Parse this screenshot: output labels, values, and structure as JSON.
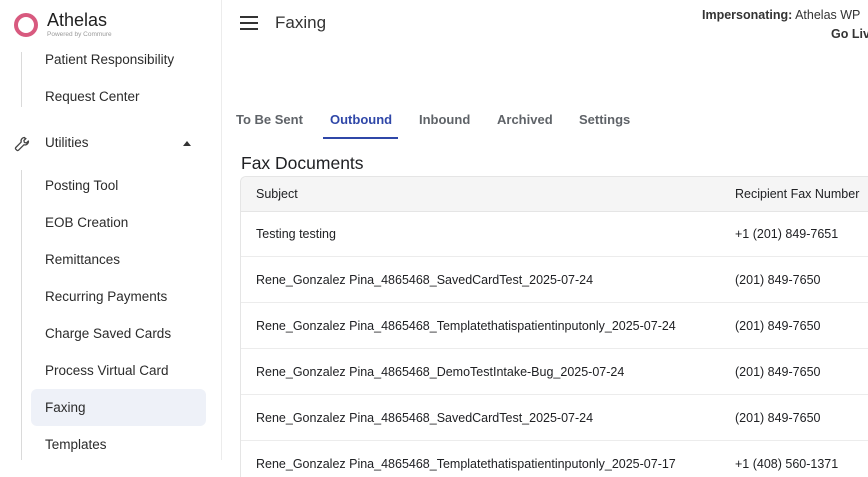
{
  "brand": {
    "name": "Athelas",
    "sub": "Powered by Commure"
  },
  "sidebar": {
    "partial_item": "Patient Responsibility",
    "request_center": "Request Center",
    "utilities": "Utilities",
    "items": [
      {
        "label": "Posting Tool"
      },
      {
        "label": "EOB Creation"
      },
      {
        "label": "Remittances"
      },
      {
        "label": "Recurring Payments"
      },
      {
        "label": "Charge Saved Cards"
      },
      {
        "label": "Process Virtual Card"
      },
      {
        "label": "Faxing"
      },
      {
        "label": "Templates"
      }
    ],
    "active": "Faxing"
  },
  "header": {
    "title": "Faxing",
    "impersonating_label": "Impersonating:",
    "impersonating_value": "Athelas WP",
    "go_live": "Go Liv"
  },
  "tabs": [
    {
      "label": "To Be Sent"
    },
    {
      "label": "Outbound"
    },
    {
      "label": "Inbound"
    },
    {
      "label": "Archived"
    },
    {
      "label": "Settings"
    }
  ],
  "active_tab": "Outbound",
  "section_title": "Fax Documents",
  "table": {
    "columns": [
      "Subject",
      "Recipient Fax Number"
    ],
    "rows": [
      {
        "subject": "Testing testing",
        "fax": "+1 (201) 849-7651"
      },
      {
        "subject": "Rene_Gonzalez Pina_4865468_SavedCardTest_2025-07-24",
        "fax": "(201) 849-7650"
      },
      {
        "subject": "Rene_Gonzalez Pina_4865468_Templatethatispatientinputonly_2025-07-24",
        "fax": "(201) 849-7650"
      },
      {
        "subject": "Rene_Gonzalez Pina_4865468_DemoTestIntake-Bug_2025-07-24",
        "fax": "(201) 849-7650"
      },
      {
        "subject": "Rene_Gonzalez Pina_4865468_SavedCardTest_2025-07-24",
        "fax": "(201) 849-7650"
      },
      {
        "subject": "Rene_Gonzalez Pina_4865468_Templatethatispatientinputonly_2025-07-17",
        "fax": "+1 (408) 560-1371"
      }
    ]
  },
  "colors": {
    "accent": "#2f47a8",
    "brand": "#d85a7f",
    "active_bg": "#eef1f8"
  }
}
